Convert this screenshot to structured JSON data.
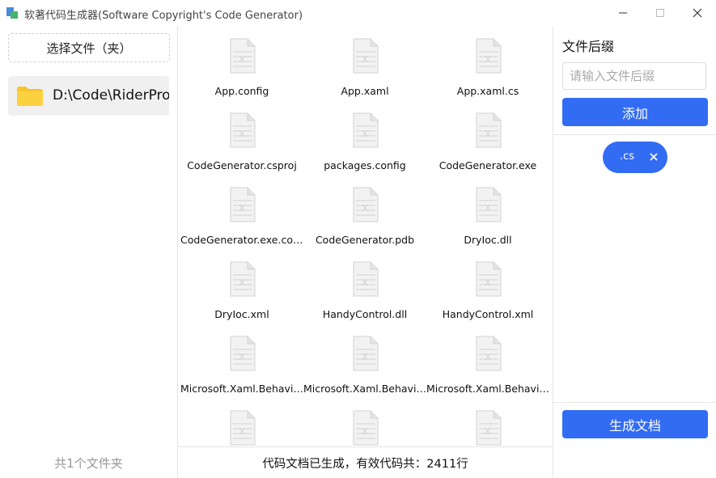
{
  "window": {
    "title": "软著代码生成器(Software Copyright's Code Generator)",
    "controls": [
      "minimize",
      "maximize",
      "close"
    ]
  },
  "left_panel": {
    "select_button_label": "选择文件（夹）",
    "folders": [
      {
        "path": "D:\\Code\\RiderProjects\\CodeGenerator",
        "icon": "folder-icon"
      }
    ],
    "folder_count_text": "共1个文件夹"
  },
  "files": [
    {
      "name": "App.config"
    },
    {
      "name": "App.xaml"
    },
    {
      "name": "App.xaml.cs"
    },
    {
      "name": "CodeGenerator.csproj"
    },
    {
      "name": "packages.config"
    },
    {
      "name": "CodeGenerator.exe"
    },
    {
      "name": "CodeGenerator.exe.config"
    },
    {
      "name": "CodeGenerator.pdb"
    },
    {
      "name": "DryIoc.dll"
    },
    {
      "name": "DryIoc.xml"
    },
    {
      "name": "HandyControl.dll"
    },
    {
      "name": "HandyControl.xml"
    },
    {
      "name": "Microsoft.Xaml.Behaviors.dll"
    },
    {
      "name": "Microsoft.Xaml.Behaviors.xml"
    },
    {
      "name": "Microsoft.Xaml.Behaviors.Design.dll"
    },
    {
      "name": ""
    },
    {
      "name": ""
    },
    {
      "name": ""
    }
  ],
  "status_text": "代码文档已生成，有效代码共：2411行",
  "right_panel": {
    "title": "文件后缀",
    "input_placeholder": "请输入文件后缀",
    "input_value": "",
    "add_button_label": "添加",
    "tags": [
      {
        "label": ".cs",
        "close_icon": "close-icon"
      }
    ],
    "generate_button_label": "生成文档"
  },
  "colors": {
    "accent": "#326cf3",
    "folder": "#f7c52b",
    "border": "#e5e5e5",
    "muted": "#999999"
  }
}
